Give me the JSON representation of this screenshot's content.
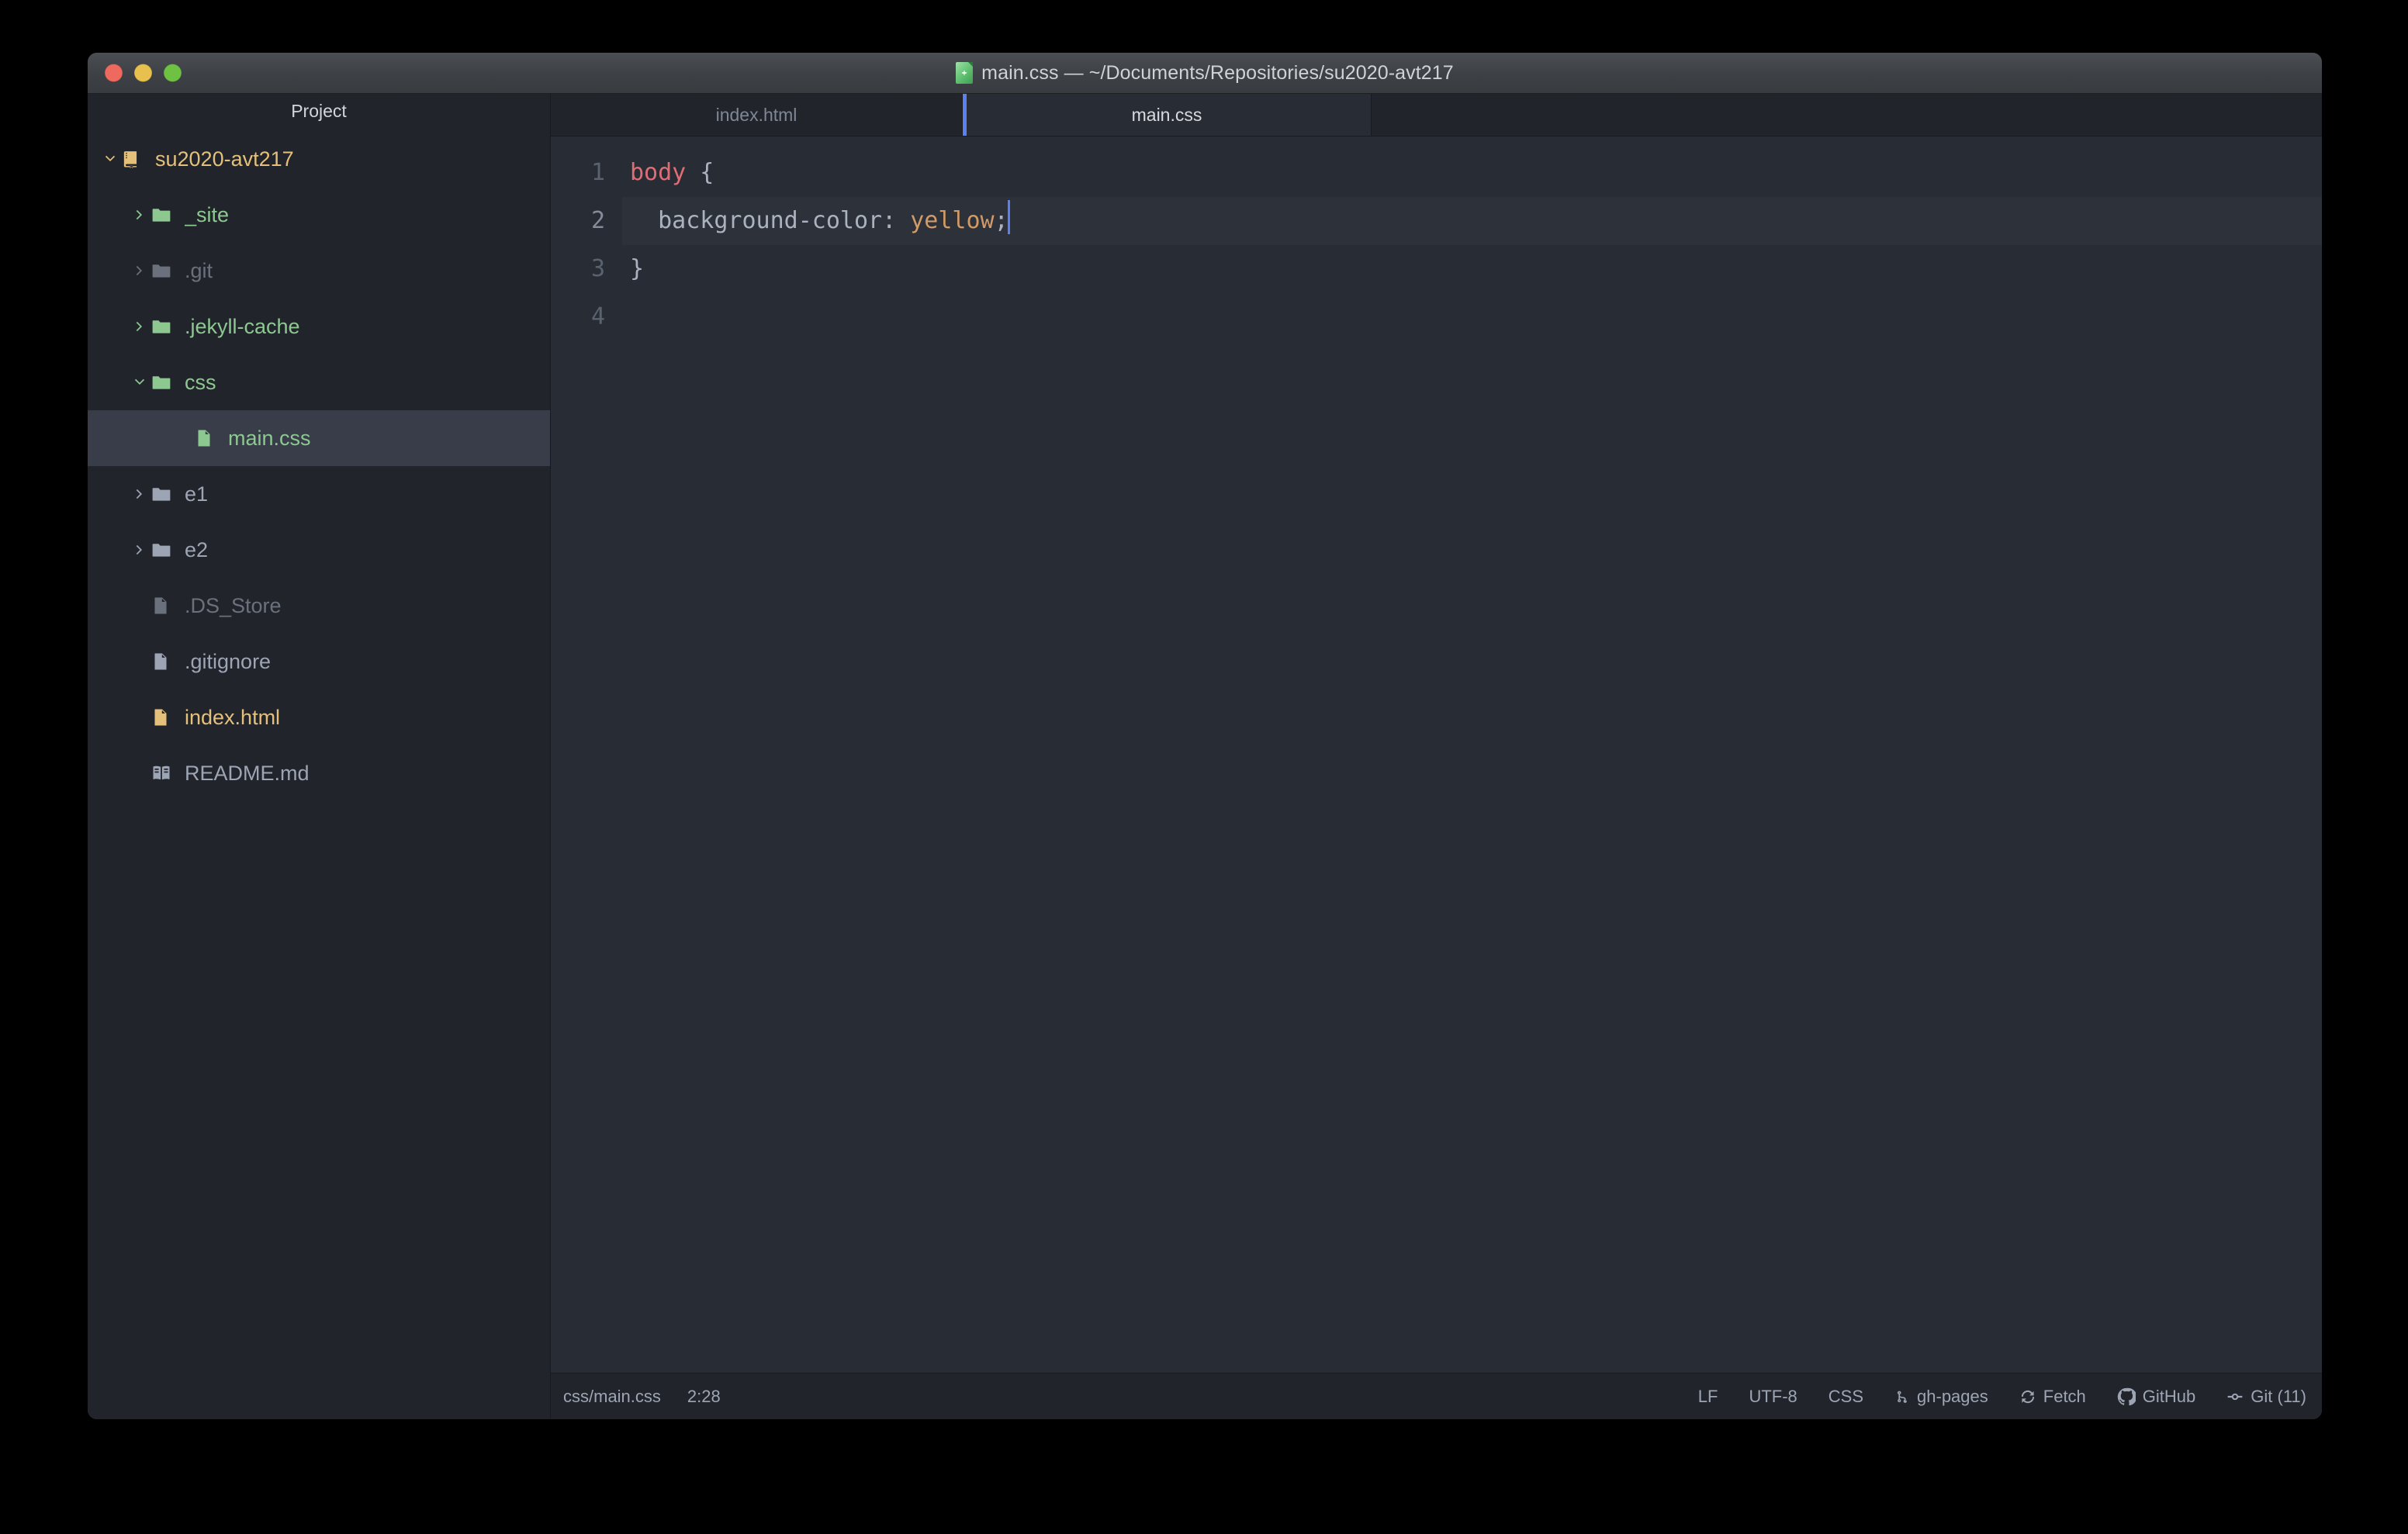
{
  "window": {
    "title": "main.css — ~/Documents/Repositories/su2020-avt217",
    "title_icon": "atom-document-icon",
    "traffic_lights": [
      {
        "name": "close",
        "color": "#ee6a5f"
      },
      {
        "name": "minimize",
        "color": "#e8c04d"
      },
      {
        "name": "zoom",
        "color": "#6fc144"
      }
    ]
  },
  "sidebar": {
    "header": "Project",
    "tree": [
      {
        "label": "su2020-avt217",
        "icon": "repo-icon",
        "twisty": "chevron-down-icon",
        "depth": 0,
        "color": "#e5c07b",
        "selected": false
      },
      {
        "label": "_site",
        "icon": "folder-icon",
        "twisty": "chevron-right-icon",
        "depth": 1,
        "color": "#8dc891",
        "selected": false
      },
      {
        "label": ".git",
        "icon": "folder-icon",
        "twisty": "chevron-right-icon",
        "depth": 1,
        "color": "#6b717c",
        "selected": false
      },
      {
        "label": ".jekyll-cache",
        "icon": "folder-icon",
        "twisty": "chevron-right-icon",
        "depth": 1,
        "color": "#8dc891",
        "selected": false
      },
      {
        "label": "css",
        "icon": "folder-icon",
        "twisty": "chevron-down-icon",
        "depth": 1,
        "color": "#8dc891",
        "selected": false
      },
      {
        "label": "main.css",
        "icon": "file-text-icon",
        "twisty": "none",
        "depth": 2,
        "color": "#8dc891",
        "selected": true
      },
      {
        "label": "e1",
        "icon": "folder-icon",
        "twisty": "chevron-right-icon",
        "depth": 1,
        "color": "#9da5b4",
        "selected": false
      },
      {
        "label": "e2",
        "icon": "folder-icon",
        "twisty": "chevron-right-icon",
        "depth": 1,
        "color": "#9da5b4",
        "selected": false
      },
      {
        "label": ".DS_Store",
        "icon": "file-text-icon",
        "twisty": "none",
        "depth": 1,
        "color": "#6b717c",
        "selected": false
      },
      {
        "label": ".gitignore",
        "icon": "file-text-icon",
        "twisty": "none",
        "depth": 1,
        "color": "#9da5b4",
        "selected": false
      },
      {
        "label": "index.html",
        "icon": "file-text-icon",
        "twisty": "none",
        "depth": 1,
        "color": "#e5c07b",
        "selected": false
      },
      {
        "label": "README.md",
        "icon": "book-icon",
        "twisty": "none",
        "depth": 1,
        "color": "#9da5b4",
        "selected": false
      }
    ]
  },
  "tabs": [
    {
      "label": "index.html",
      "active": false
    },
    {
      "label": "main.css",
      "active": true
    }
  ],
  "editor": {
    "language": "CSS",
    "accent_color": "#5c80f0",
    "line_numbers": [
      "1",
      "2",
      "3",
      "4"
    ],
    "active_line": 2,
    "lines": [
      {
        "num": "1",
        "tokens": [
          {
            "text": "body",
            "type": "selector"
          },
          {
            "text": " {",
            "type": "punctuation"
          }
        ]
      },
      {
        "num": "2",
        "tokens": [
          {
            "text": "  background-color",
            "type": "property"
          },
          {
            "text": ": ",
            "type": "punctuation"
          },
          {
            "text": "yellow",
            "type": "value"
          },
          {
            "text": ";",
            "type": "punctuation"
          }
        ]
      },
      {
        "num": "3",
        "tokens": [
          {
            "text": "}",
            "type": "punctuation"
          }
        ]
      },
      {
        "num": "4",
        "tokens": []
      }
    ]
  },
  "statusbar": {
    "left": [
      {
        "name": "file-path",
        "label": "css/main.css"
      },
      {
        "name": "cursor-position",
        "label": "2:28"
      }
    ],
    "right": [
      {
        "name": "line-ending",
        "label": "LF",
        "icon": "none"
      },
      {
        "name": "encoding",
        "label": "UTF-8",
        "icon": "none"
      },
      {
        "name": "grammar",
        "label": "CSS",
        "icon": "none"
      },
      {
        "name": "git-branch",
        "label": "gh-pages",
        "icon": "git-branch-icon"
      },
      {
        "name": "git-fetch",
        "label": "Fetch",
        "icon": "sync-icon"
      },
      {
        "name": "github",
        "label": "GitHub",
        "icon": "github-icon"
      },
      {
        "name": "git-changes",
        "label": "Git (11)",
        "icon": "git-commit-icon"
      }
    ]
  }
}
